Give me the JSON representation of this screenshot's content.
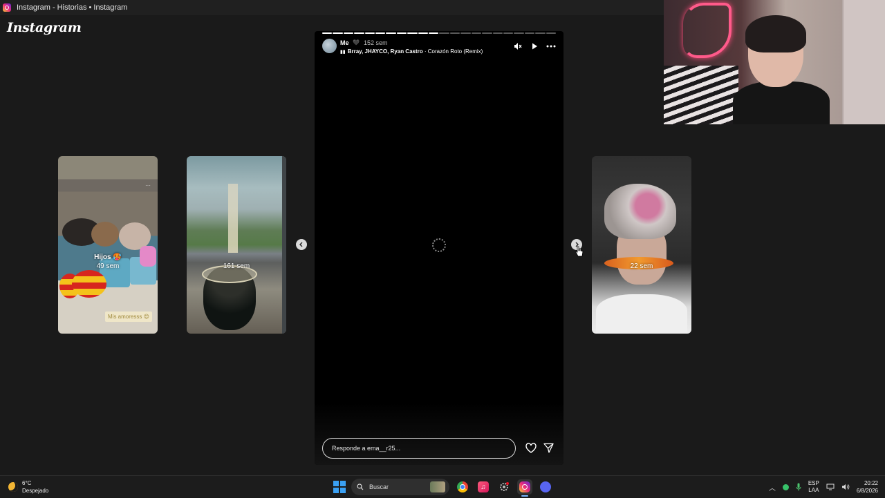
{
  "window": {
    "title": "Instagram - Historias • Instagram"
  },
  "brand": {
    "logo_text": "Instagram"
  },
  "side_stories": [
    {
      "title": "Hijos 🥵",
      "age": "49 sem",
      "sticker": "Mis amoresss 😍"
    },
    {
      "title": "",
      "age": "161 sem"
    },
    {
      "title": "",
      "age": "22 sem"
    }
  ],
  "story": {
    "user": "Me",
    "heart": "🖤",
    "age": "152 sem",
    "song_artists": "Brray, JHAYCO, Ryan Castro",
    "song_title": " · Corazón Roto (Remix)",
    "progress_total": 22,
    "progress_done": 11,
    "reply_placeholder": "Responde a ema__r25..."
  },
  "taskbar": {
    "temperature": "6°C",
    "weather": "Despejado",
    "search_label": "Buscar",
    "lang_line1": "ESP",
    "lang_line2": "LAA",
    "time": "20:22",
    "date": "6/8/2026"
  },
  "colors": {
    "accent_blue": "#3aa0f3",
    "background": "#1a1a1a"
  }
}
